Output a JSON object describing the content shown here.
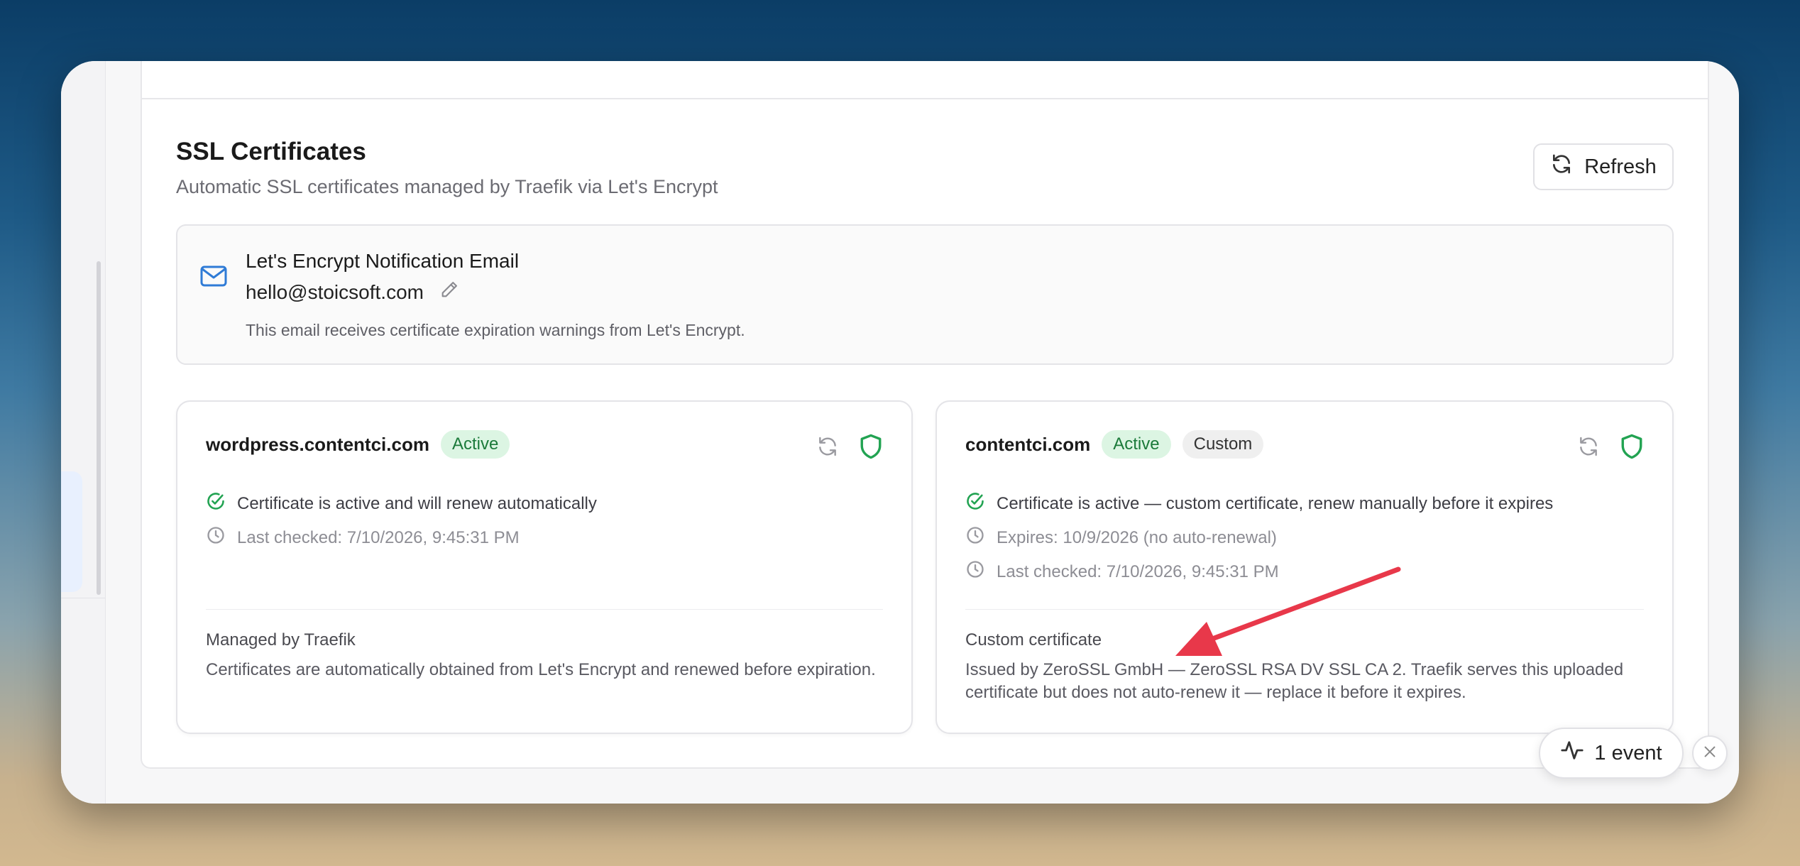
{
  "header": {
    "title": "SSL Certificates",
    "subtitle": "Automatic SSL certificates managed by Traefik via Let's Encrypt",
    "refresh_label": "Refresh"
  },
  "email_box": {
    "title": "Let's Encrypt Notification Email",
    "email": "hello@stoicsoft.com",
    "note": "This email receives certificate expiration warnings from Let's Encrypt."
  },
  "cards": [
    {
      "domain": "wordpress.contentci.com",
      "status": "Active",
      "status_line": "Certificate is active and will renew automatically",
      "last_checked": "Last checked: 7/10/2026, 9:45:31 PM",
      "footer_title": "Managed by Traefik",
      "footer_text": "Certificates are automatically obtained from Let's Encrypt and renewed before expiration."
    },
    {
      "domain": "contentci.com",
      "status": "Active",
      "tag": "Custom",
      "status_line": "Certificate is active — custom certificate, renew manually before it expires",
      "expires": "Expires: 10/9/2026 (no auto-renewal)",
      "last_checked": "Last checked: 7/10/2026, 9:45:31 PM",
      "footer_title": "Custom certificate",
      "footer_text": "Issued by ZeroSSL GmbH — ZeroSSL RSA DV SSL CA 2. Traefik serves this uploaded certificate but does not auto-renew it — replace it before it expires."
    }
  ],
  "events": {
    "label": "1 event"
  },
  "colors": {
    "accent_blue": "#2f7bd6",
    "active_green": "#22a352",
    "badge_green_bg": "#dcf5e3",
    "annotation_red": "#e8384a"
  },
  "icons": [
    "refresh-icon",
    "mail-icon",
    "pencil-icon",
    "shield-icon",
    "check-circle-icon",
    "clock-icon",
    "activity-icon",
    "close-icon",
    "annotation-arrow"
  ]
}
